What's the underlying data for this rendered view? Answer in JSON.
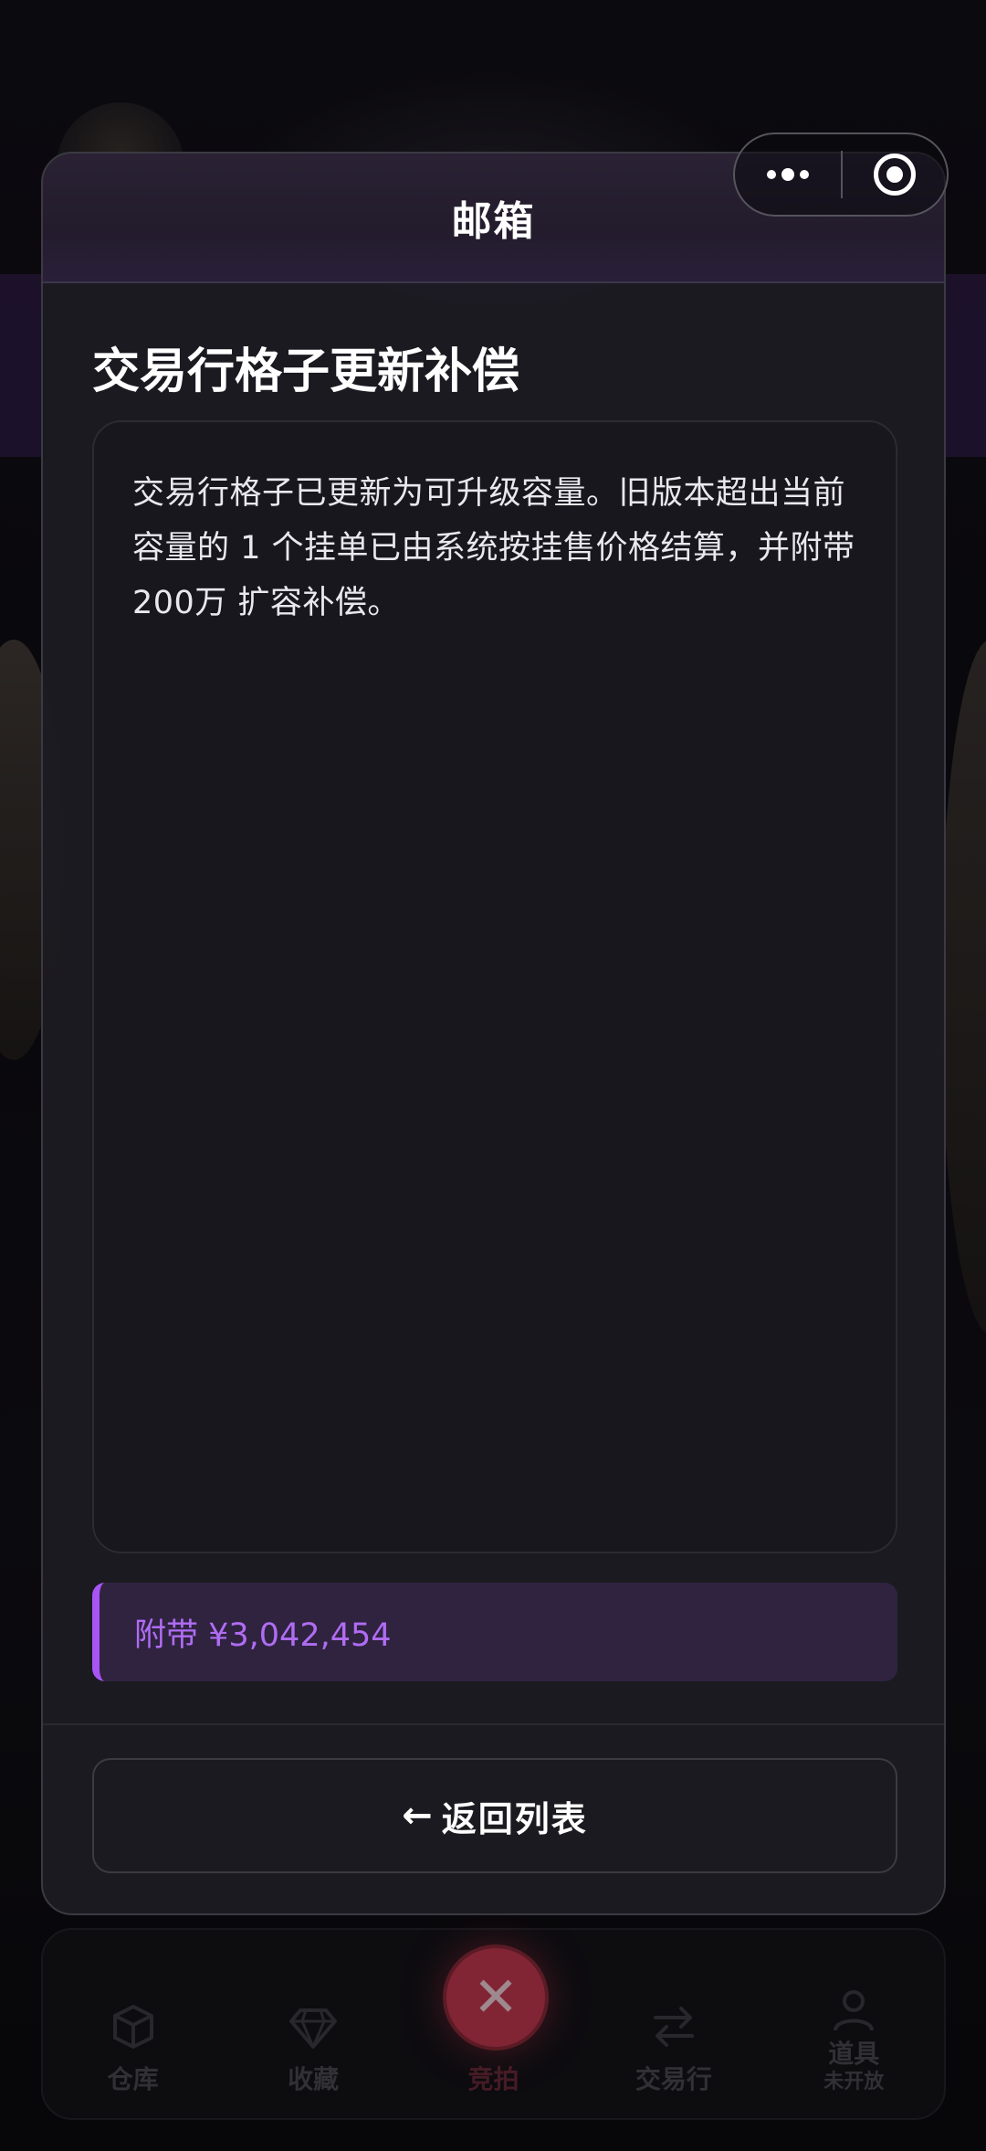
{
  "capsule": {
    "more_icon": "more-dots-icon",
    "close_icon": "target-close-icon"
  },
  "modal": {
    "title": "邮箱",
    "subject": "交易行格子更新补偿",
    "body": "交易行格子已更新为可升级容量。旧版本超出当前容量的 1 个挂单已由系统按挂售价格结算，并附带 200万 扩容补偿。",
    "attachment": "附带 ¥3,042,454",
    "back_arrow": "←",
    "back_label": "返回列表"
  },
  "bottom_nav": {
    "items": [
      {
        "label": "仓库",
        "icon": "cube-icon"
      },
      {
        "label": "收藏",
        "icon": "diamond-icon"
      },
      {
        "label": "竞拍",
        "icon": "close-icon",
        "active": true
      },
      {
        "label": "交易行",
        "icon": "swap-arrows-icon"
      },
      {
        "label": "道具",
        "sub": "未开放",
        "icon": "user-icon"
      }
    ],
    "center_symbol": "✕"
  },
  "colors": {
    "accent_purple": "#a855f7",
    "attachment_text": "#b06cf3",
    "center_button": "#c63a52"
  }
}
